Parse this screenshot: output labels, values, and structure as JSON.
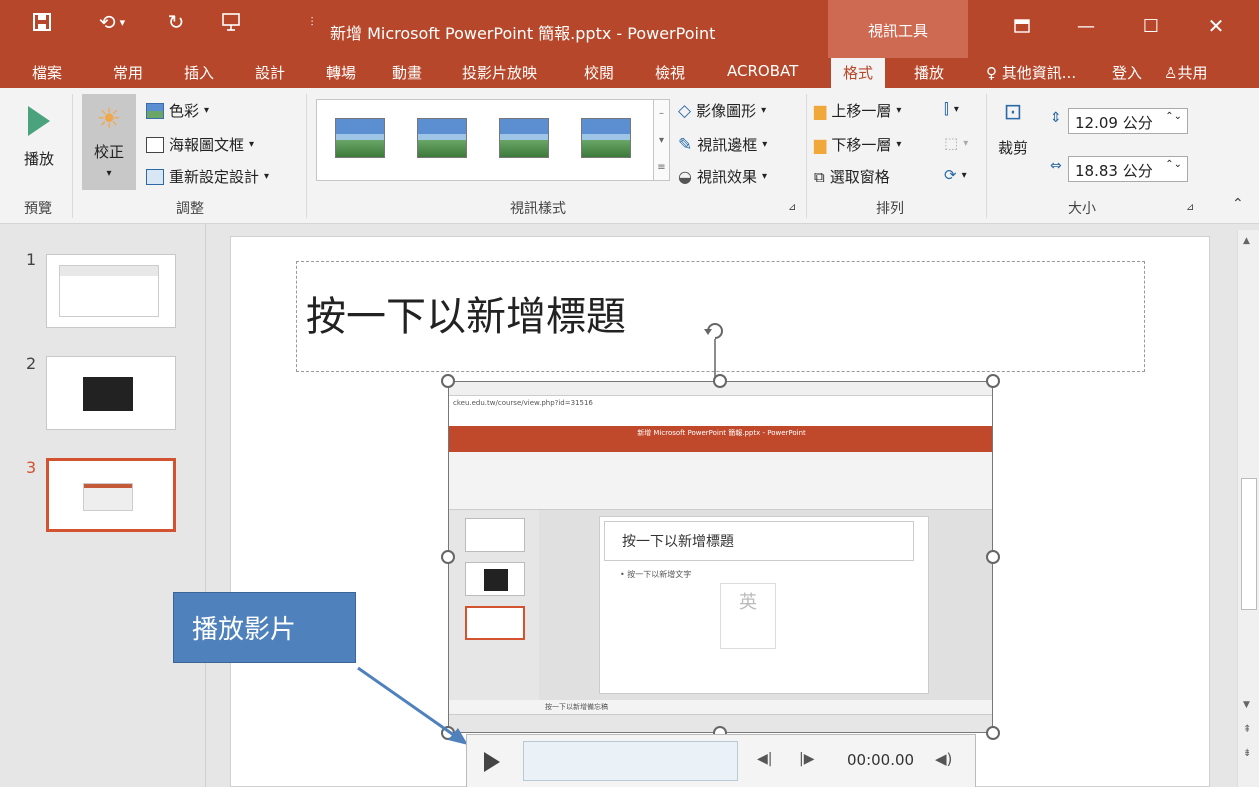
{
  "window": {
    "title": "新增 Microsoft PowerPoint 簡報.pptx - PowerPoint",
    "context_tab": "視訊工具",
    "accent": "#b7472a"
  },
  "tabs": {
    "items": [
      "檔案",
      "常用",
      "插入",
      "設計",
      "轉場",
      "動畫",
      "投影片放映",
      "校閱",
      "檢視",
      "ACROBAT",
      "格式",
      "播放"
    ],
    "active": "格式",
    "tell_me": "其他資訊...",
    "signin": "登入",
    "share": "共用"
  },
  "ribbon": {
    "preview": {
      "play": "播放",
      "group": "預覽"
    },
    "adjust": {
      "corrections": "校正",
      "color": "色彩",
      "poster_frame": "海報圖文框",
      "reset": "重新設定設計",
      "group": "調整"
    },
    "video_styles": {
      "shape": "影像圖形",
      "border": "視訊邊框",
      "effects": "視訊效果",
      "group": "視訊樣式"
    },
    "arrange": {
      "bring_forward": "上移一層",
      "send_backward": "下移一層",
      "selection_pane": "選取窗格",
      "group": "排列"
    },
    "size": {
      "crop": "裁剪",
      "height": "12.09 公分",
      "width": "18.83 公分",
      "group": "大小"
    }
  },
  "slides": {
    "numbers": [
      "1",
      "2",
      "3"
    ],
    "selected": "3"
  },
  "slide": {
    "title": "按一下以新增標題",
    "callout": "播放影片"
  },
  "embedded": {
    "url": "ckeu.edu.tw/course/view.php?id=31516",
    "app_title": "新增 Microsoft PowerPoint 簡報.pptx - PowerPoint",
    "title": "按一下以新增標題",
    "bullet": "• 按一下以新增文字",
    "placeholder_char": "英",
    "notes": "按一下以新增備忘稿"
  },
  "player": {
    "time": "00:00.00"
  }
}
